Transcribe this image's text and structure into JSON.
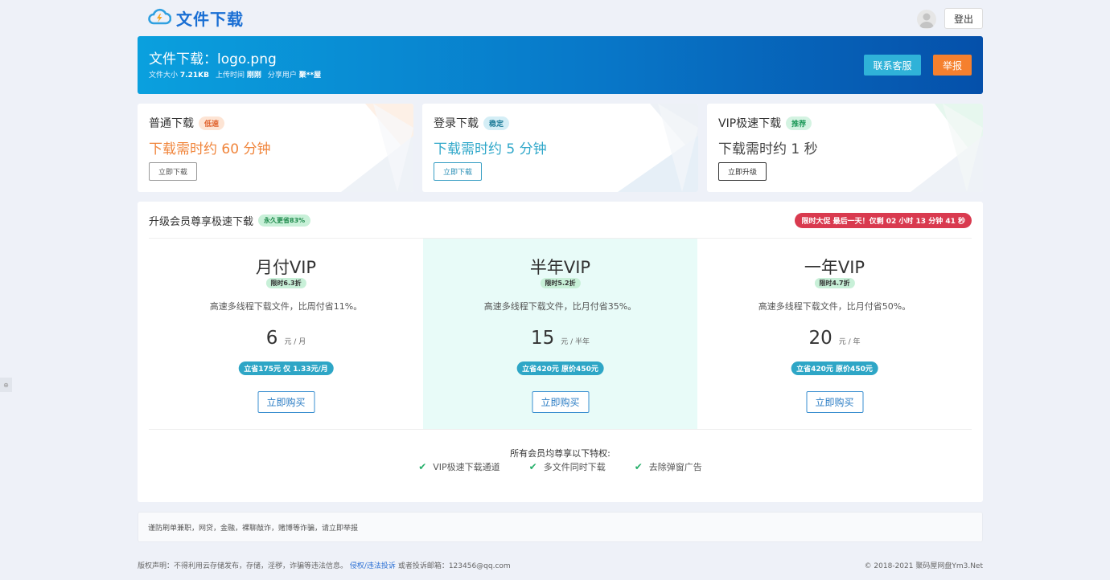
{
  "header": {
    "logo_text": "文件下载",
    "logout_label": "登出"
  },
  "banner": {
    "title_prefix": "文件下载：",
    "filename": "logo.png",
    "size_label": "文件大小",
    "size_value": "7.21KB",
    "upload_label": "上传时间",
    "upload_value": "刚刚",
    "user_label": "分享用户",
    "user_value": "聚**屋",
    "service_button": "联系客服",
    "report_button": "举报"
  },
  "cards": [
    {
      "name": "普通下载",
      "badge": "低速",
      "time": "下载需时约 60 分钟",
      "button": "立即下载",
      "color": "#f0843a",
      "badge_bg": "#fde4d4",
      "badge_fg": "#e0622c",
      "btn_border": "#999999",
      "btn_fg": "#555555"
    },
    {
      "name": "登录下载",
      "badge": "稳定",
      "time": "下载需时约 5 分钟",
      "button": "立即下载",
      "color": "#2fa7c9",
      "badge_bg": "#d4eef6",
      "badge_fg": "#1f7d99",
      "btn_border": "#3a9fc4",
      "btn_fg": "#2a8fb6"
    },
    {
      "name": "VIP极速下载",
      "badge": "推荐",
      "time": "下载需时约 1 秒",
      "button": "立即升级",
      "color": "#444444",
      "badge_bg": "#d4f3e2",
      "badge_fg": "#1f9a5a",
      "btn_border": "#333333",
      "btn_fg": "#333333"
    }
  ],
  "vip": {
    "heading": "升级会员尊享极速下载",
    "heading_badge": "永久更省83%",
    "promo": "限时大促 最后一天！仅剩 02 小时 13 分钟 41 秒",
    "plans": [
      {
        "name": "月付VIP",
        "discount": "限时6.3折",
        "desc": "高速多线程下载文件，比周付省11%。",
        "price": "6",
        "unit": "元 / 月",
        "save": "立省175元 仅 1.33元/月",
        "buy": "立即购买"
      },
      {
        "name": "半年VIP",
        "discount": "限时5.2折",
        "desc": "高速多线程下载文件，比月付省35%。",
        "price": "15",
        "unit": "元 / 半年",
        "save": "立省420元 原价450元",
        "buy": "立即购买"
      },
      {
        "name": "一年VIP",
        "discount": "限时4.7折",
        "desc": "高速多线程下载文件，比月付省50%。",
        "price": "20",
        "unit": "元 / 年",
        "save": "立省420元 原价450元",
        "buy": "立即购买"
      }
    ],
    "perks_title": "所有会员均尊享以下特权:",
    "perks": [
      "VIP极速下载通道",
      "多文件同时下载",
      "去除弹窗广告"
    ]
  },
  "notice": "谨防刷单兼职，网贷，金融，裸聊敲诈，赌博等诈骗，请立即举报",
  "footer": {
    "left_text": "版权声明：不得利用云存储发布，存储，淫秽，诈骗等违法信息。",
    "link": "侵权/违法投诉",
    "email_text": "或者投诉邮箱：123456@qq.com",
    "right_text": "© 2018-2021 聚码屋网盘Ym3.Net"
  },
  "side_tab": "⊕"
}
